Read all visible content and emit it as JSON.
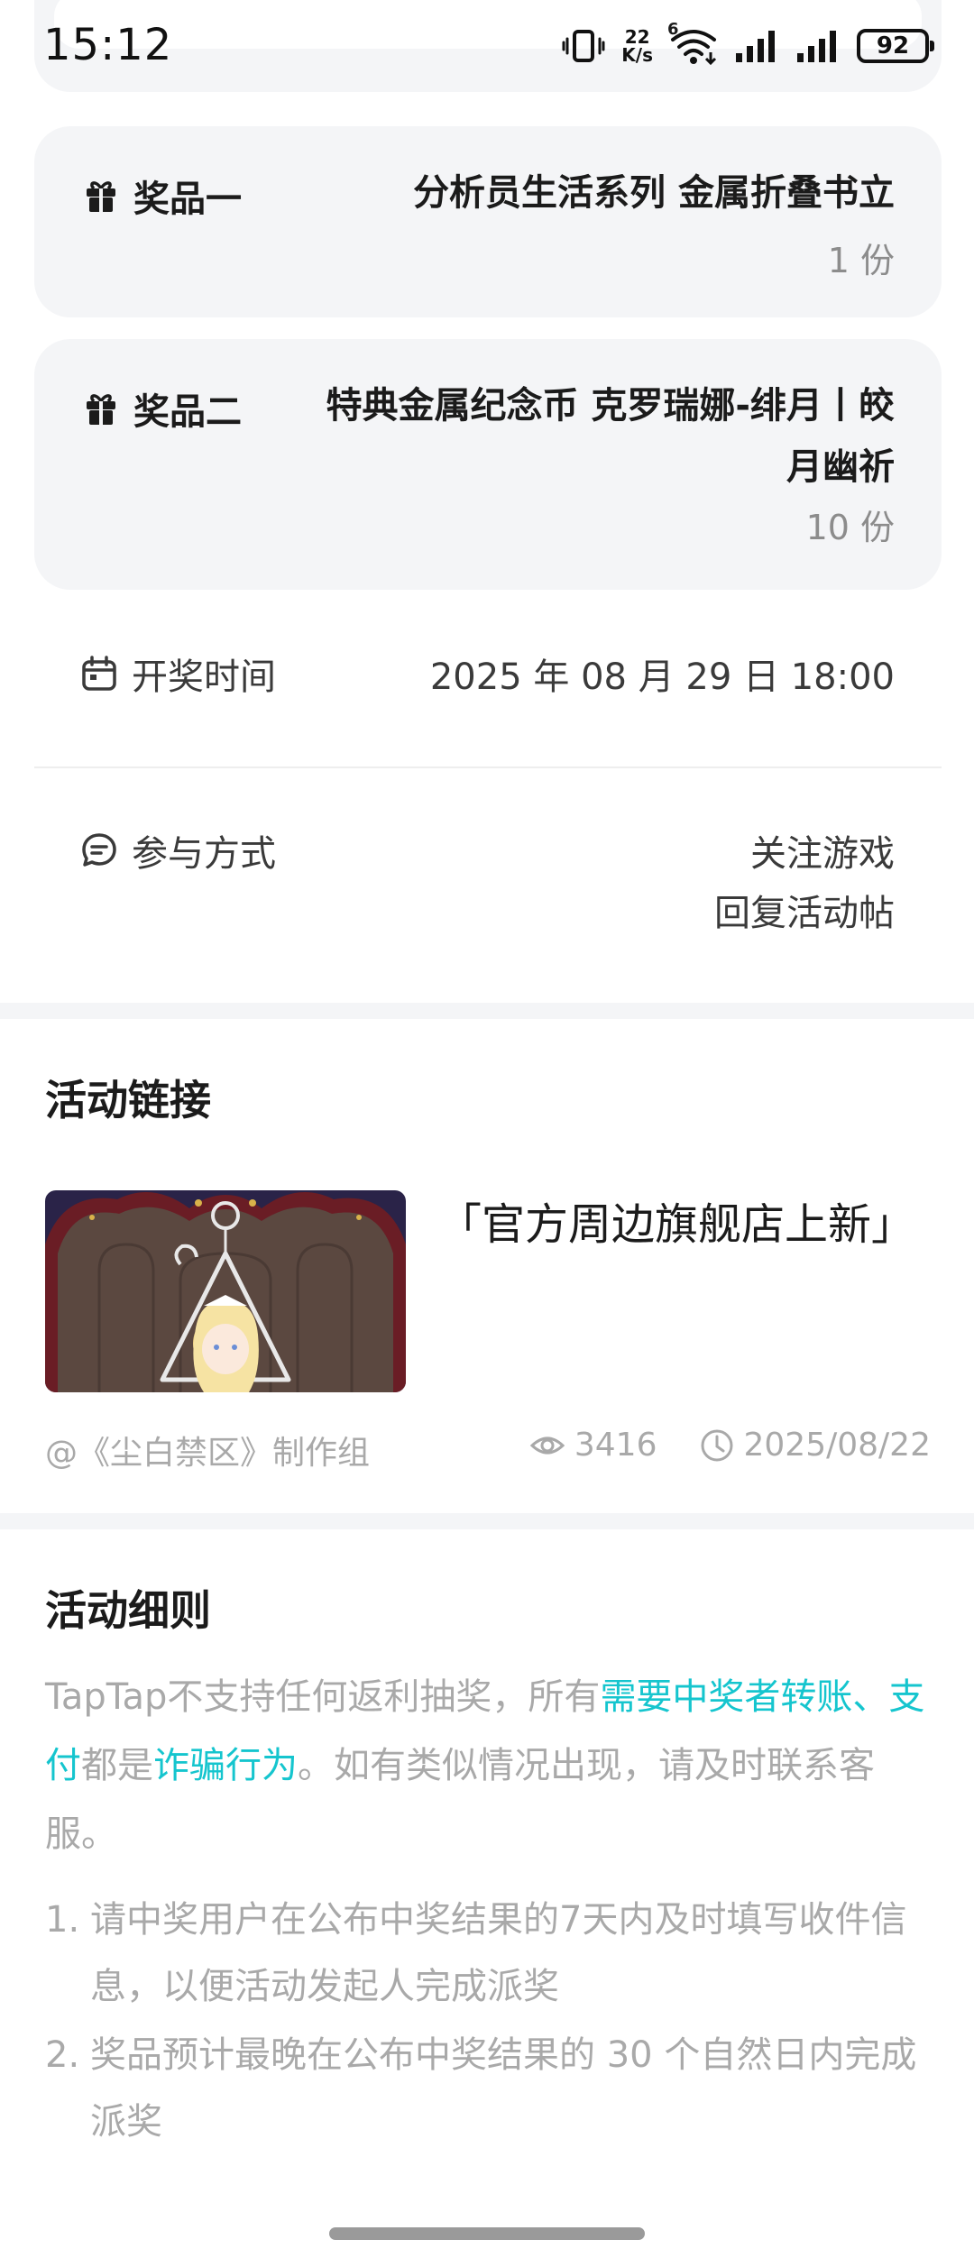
{
  "status_bar": {
    "time": "15:12",
    "net_speed_value": "22",
    "net_speed_unit": "K/s",
    "wifi_label": "6",
    "battery": "92"
  },
  "prizes": [
    {
      "label": "奖品一",
      "name": "分析员生活系列 金属折叠书立",
      "quantity": "1 份"
    },
    {
      "label": "奖品二",
      "name": "特典金属纪念币 克罗瑞娜-绯月丨皎月幽祈",
      "quantity": "10 份"
    }
  ],
  "draw_time": {
    "label": "开奖时间",
    "value": "2025 年 08 月 29 日 18:00"
  },
  "participation": {
    "label": "参与方式",
    "methods": [
      "关注游戏",
      "回复活动帖"
    ]
  },
  "activity_link": {
    "section_title": "活动链接",
    "title": "「官方周边旗舰店上新」",
    "author": "@《尘白禁区》制作组",
    "views": "3416",
    "date": "2025/08/22"
  },
  "rules": {
    "section_title": "活动细则",
    "intro_parts": [
      "TapTap不支持任何返利抽奖，所有",
      "需要中奖者转账、支付",
      "都是",
      "诈骗行为",
      "。如有类似情况出现，请及时联系客服。"
    ],
    "highlight_color": "#15c5ce",
    "items": [
      {
        "num": "1.",
        "text": "请中奖用户在公布中奖结果的7天内及时填写收件信息，以便活动发起人完成派奖"
      },
      {
        "num": "2.",
        "text": "奖品预计最晚在公布中奖结果的 30 个自然日内完成派奖"
      }
    ]
  },
  "icons": {
    "prize": "gift-icon",
    "draw_time": "calendar-icon",
    "participation": "chat-bubble-icon",
    "views": "eye-icon",
    "date": "clock-icon"
  }
}
